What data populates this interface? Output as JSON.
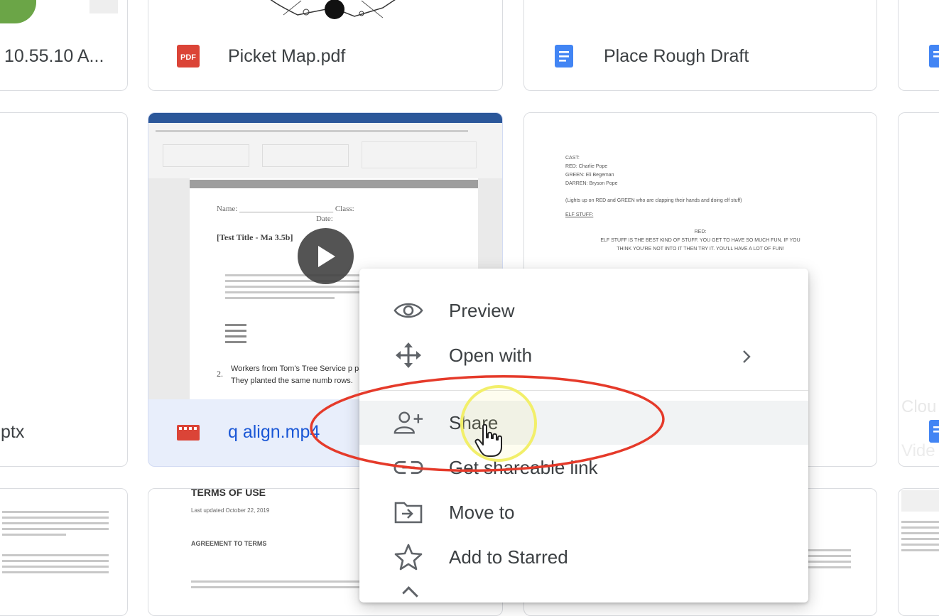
{
  "files": {
    "row1": [
      {
        "name": "10.55.10 A...",
        "type": "image"
      },
      {
        "name": "Picket Map.pdf",
        "type": "pdf"
      },
      {
        "name": "Place Rough Draft",
        "type": "doc"
      }
    ],
    "row2": [
      {
        "name": "ptx",
        "type": "slides"
      },
      {
        "name": "q align.mp4",
        "type": "video"
      },
      {
        "name": "",
        "type": "doc"
      }
    ],
    "row3_labels": {
      "terms_title": "TERMS OF USE",
      "terms_updated": "Last updated October 22, 2019",
      "terms_heading": "AGREEMENT TO TERMS"
    },
    "badge_pdf": "PDF"
  },
  "play_doc": {
    "name_label": "Name:",
    "class_label": "Class:",
    "date_label": "Date:",
    "title": "[Test Title - Ma 3.5b]",
    "problem": "Workers from Tom's Tree Service p park. They planted the same numb rows.",
    "problem_num": "2."
  },
  "script_doc": {
    "lines": [
      "CAST:",
      "RED: Charlie Pope",
      "GREEN: Eli Begeman",
      "DARREN: Bryson Pope",
      "(Lights up on RED and GREEN who are clapping their hands and doing elf stuff)",
      "ELF STUFF:",
      "RED:",
      "ELF STUFF IS THE BEST KIND OF STUFF. YOU GET TO HAVE SO MUCH FUN. IF YOU",
      "THINK YOU'RE NOT INTO IT THEN TRY IT. YOU'LL HAVE A LOT OF FUN!"
    ]
  },
  "right_partial": {
    "label1": "Clou",
    "label2": "Vide"
  },
  "context_menu": {
    "items": [
      {
        "label": "Preview",
        "icon": "eye-icon"
      },
      {
        "label": "Open with",
        "icon": "move-arrows-icon",
        "submenu": true
      },
      {
        "label": "Share",
        "icon": "person-add-icon",
        "active": true
      },
      {
        "label": "Get shareable link",
        "icon": "link-icon"
      },
      {
        "label": "Move to",
        "icon": "folder-move-icon"
      },
      {
        "label": "Add to Starred",
        "icon": "star-icon"
      }
    ]
  },
  "colors": {
    "accent_blue": "#4285f4",
    "pdf_red": "#db4437",
    "annotation_red": "#e53a2a",
    "cursor_highlight": "#f5f27a",
    "selected_video_bg": "#e8eefb"
  }
}
